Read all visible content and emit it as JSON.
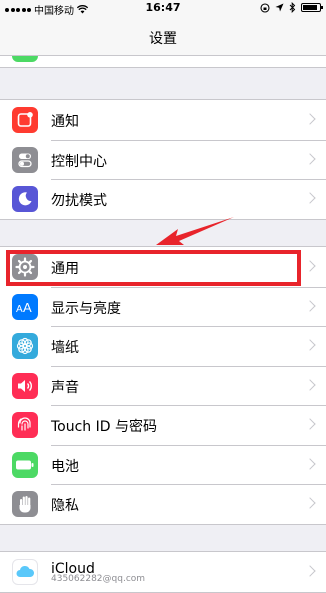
{
  "status_bar": {
    "carrier": "中国移动",
    "time": "16:47",
    "battery_level": 0.85
  },
  "nav": {
    "title": "设置"
  },
  "groups": [
    {
      "items": [
        {
          "label": "通知",
          "icon": "notifications-icon",
          "color": "#ff3b30"
        },
        {
          "label": "控制中心",
          "icon": "control-center-icon",
          "color": "#8e8e93"
        },
        {
          "label": "勿扰模式",
          "icon": "moon-icon",
          "color": "#5856d6"
        }
      ]
    },
    {
      "items": [
        {
          "label": "通用",
          "icon": "gear-icon",
          "color": "#8e8e93"
        },
        {
          "label": "显示与亮度",
          "icon": "display-brightness-icon",
          "color": "#007aff"
        },
        {
          "label": "墙纸",
          "icon": "wallpaper-icon",
          "color": "#34aadc"
        },
        {
          "label": "声音",
          "icon": "speaker-icon",
          "color": "#ff2d55"
        },
        {
          "label": "Touch ID 与密码",
          "icon": "fingerprint-icon",
          "color": "#ff2d55"
        },
        {
          "label": "电池",
          "icon": "battery-icon",
          "color": "#4cd964"
        },
        {
          "label": "隐私",
          "icon": "hand-icon",
          "color": "#8e8e93"
        }
      ]
    },
    {
      "items": [
        {
          "label": "iCloud",
          "sublabel": "435062282@qq.com",
          "icon": "cloud-icon",
          "color": "#ffffff"
        }
      ]
    }
  ],
  "annotation": {
    "color": "#e8242b"
  }
}
